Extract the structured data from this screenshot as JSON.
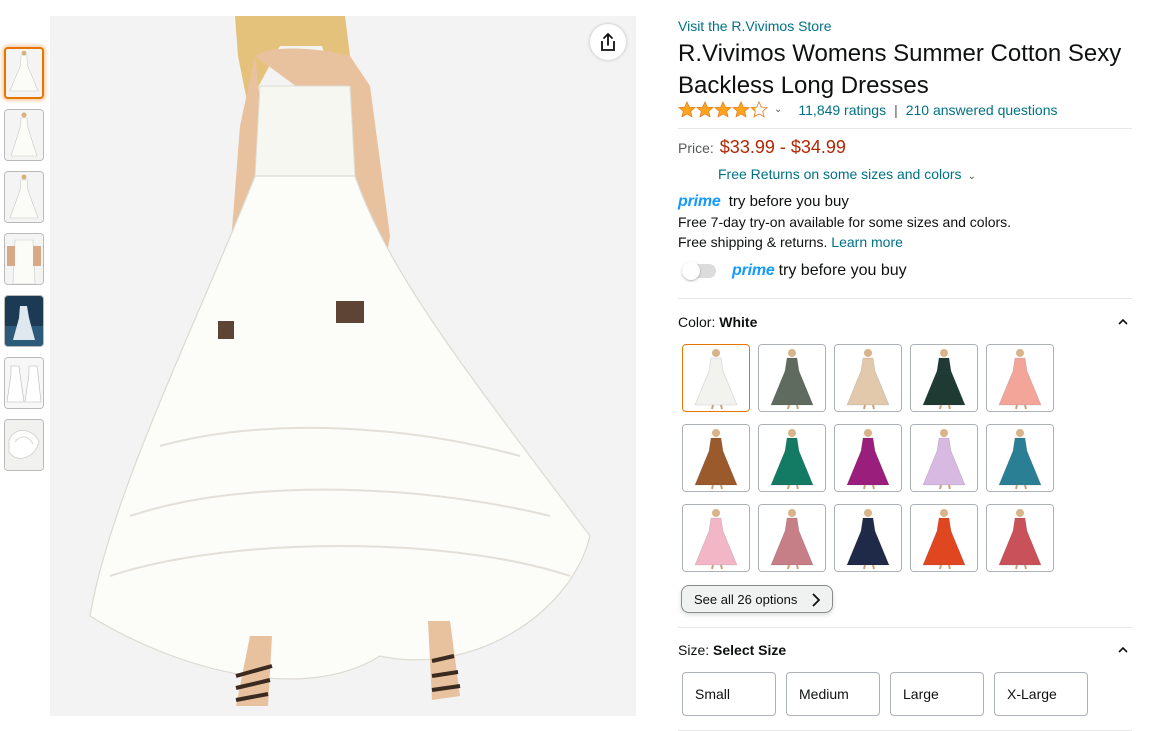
{
  "store_link": "Visit the R.Vivimos Store",
  "title": "R.Vivimos Womens Summer Cotton Sexy Backless Long Dresses",
  "rating": {
    "stars": 4.2,
    "ratings_text": "11,849 ratings",
    "separator": "|",
    "questions_text": "210 answered questions"
  },
  "price": {
    "label": "Price:",
    "value": "$33.99 - $34.99"
  },
  "free_returns": "Free Returns on some sizes and colors",
  "prime": {
    "brand": "prime",
    "tagline": "try before you buy",
    "try_text": "Free 7-day try-on available for some sizes and colors.",
    "shipping_text": "Free shipping & returns.",
    "learn_more": "Learn more",
    "toggle_brand": "prime",
    "toggle_text": "try before you buy"
  },
  "color": {
    "label": "Color:",
    "selected": "White",
    "swatches": [
      {
        "name": "White",
        "color": "#f2f2ee"
      },
      {
        "name": "Grey Green",
        "color": "#5f6b5e"
      },
      {
        "name": "Beige",
        "color": "#e2c9ab"
      },
      {
        "name": "Dark Green",
        "color": "#1e3a32"
      },
      {
        "name": "Coral Pink",
        "color": "#f3a59a"
      },
      {
        "name": "Brown",
        "color": "#9a5a2c"
      },
      {
        "name": "Green",
        "color": "#137a64"
      },
      {
        "name": "Purple",
        "color": "#9a1f7d"
      },
      {
        "name": "Lavender",
        "color": "#d7b9e2"
      },
      {
        "name": "Teal Blue",
        "color": "#2a7f94"
      },
      {
        "name": "Pink",
        "color": "#f2b6c6"
      },
      {
        "name": "Floral Mauve",
        "color": "#c77f87"
      },
      {
        "name": "Navy",
        "color": "#1f2a48"
      },
      {
        "name": "Red Orange",
        "color": "#e0461f"
      },
      {
        "name": "Rose Red",
        "color": "#c9525a"
      }
    ],
    "see_all": "See all 26 options"
  },
  "size": {
    "label": "Size:",
    "selected": "Select Size",
    "options": [
      "Small",
      "Medium",
      "Large",
      "X-Large"
    ]
  },
  "colors": {
    "link": "#007185",
    "price": "#b12704",
    "prime": "#1399ff",
    "selected_border": "#e77600",
    "star": "#ffa41c"
  },
  "thumbnails": 7
}
